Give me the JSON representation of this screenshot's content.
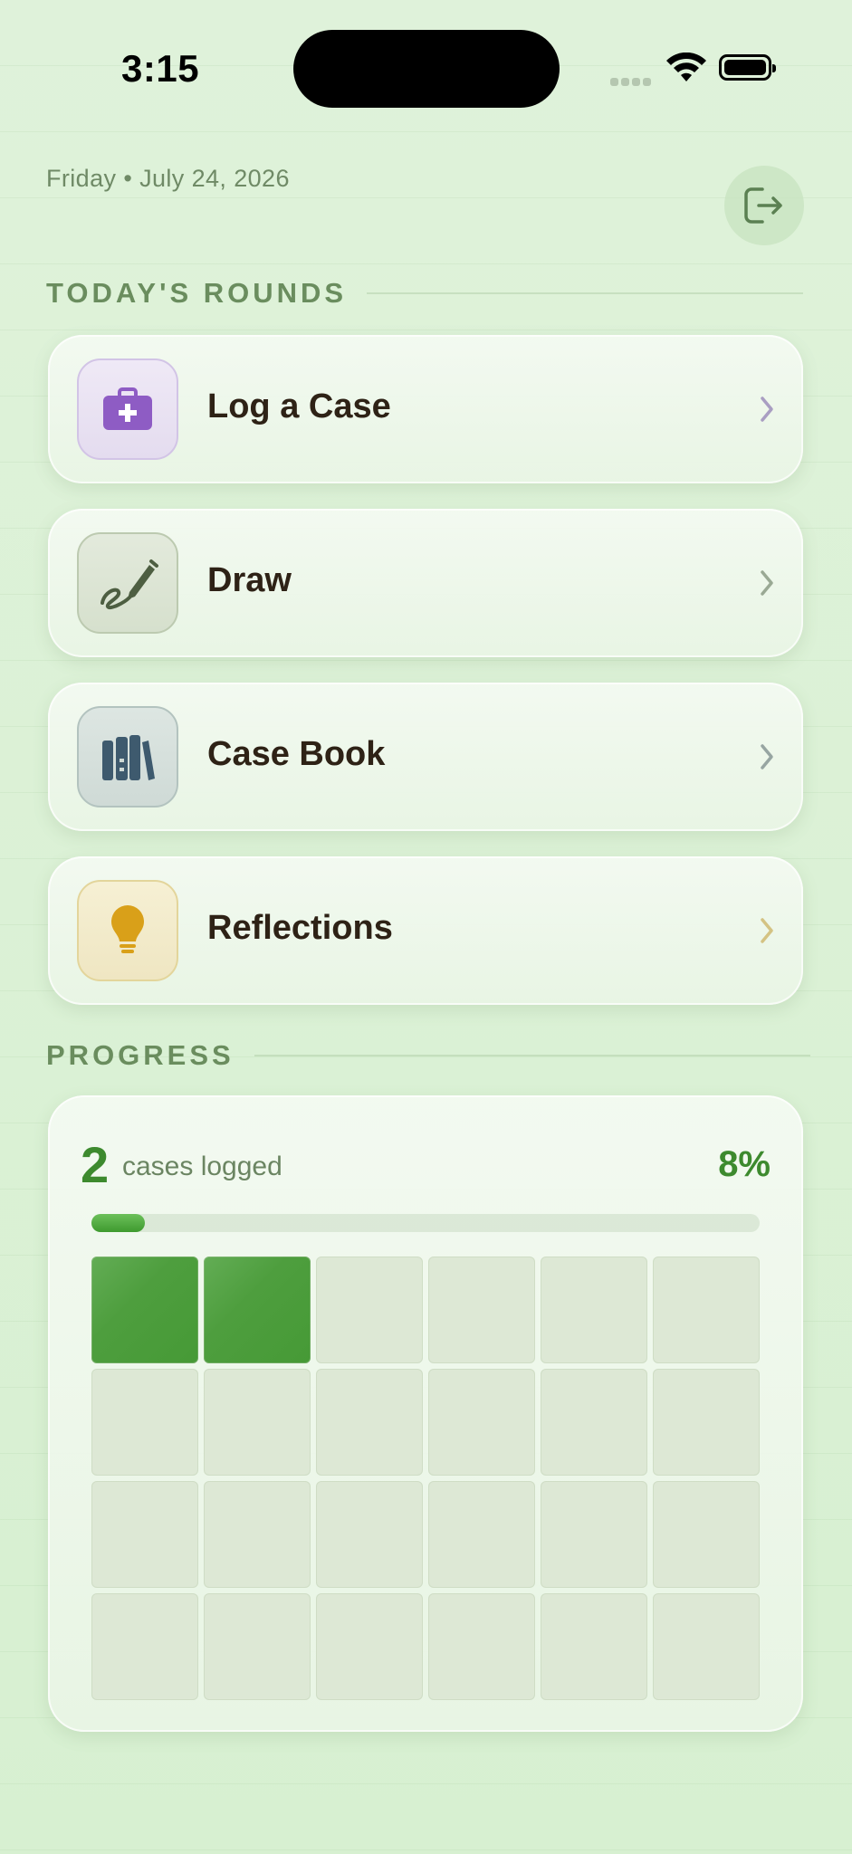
{
  "status_bar": {
    "time": "3:15"
  },
  "header": {
    "date": "Friday • July 24, 2026"
  },
  "sections": {
    "rounds_title": "TODAY'S ROUNDS",
    "progress_title": "PROGRESS"
  },
  "menu": [
    {
      "label": "Log a Case",
      "icon": "medical-kit-icon",
      "accent": "#8e5cc4"
    },
    {
      "label": "Draw",
      "icon": "pencil-scribble-icon",
      "accent": "#4d5e41"
    },
    {
      "label": "Case Book",
      "icon": "books-icon",
      "accent": "#3e5a6e"
    },
    {
      "label": "Reflections",
      "icon": "lightbulb-icon",
      "accent": "#d9a019"
    }
  ],
  "progress": {
    "count": "2",
    "count_label": "cases logged",
    "percent": "8%",
    "fraction": 0.08,
    "filled_cells": 2,
    "total_cells": 24
  }
}
